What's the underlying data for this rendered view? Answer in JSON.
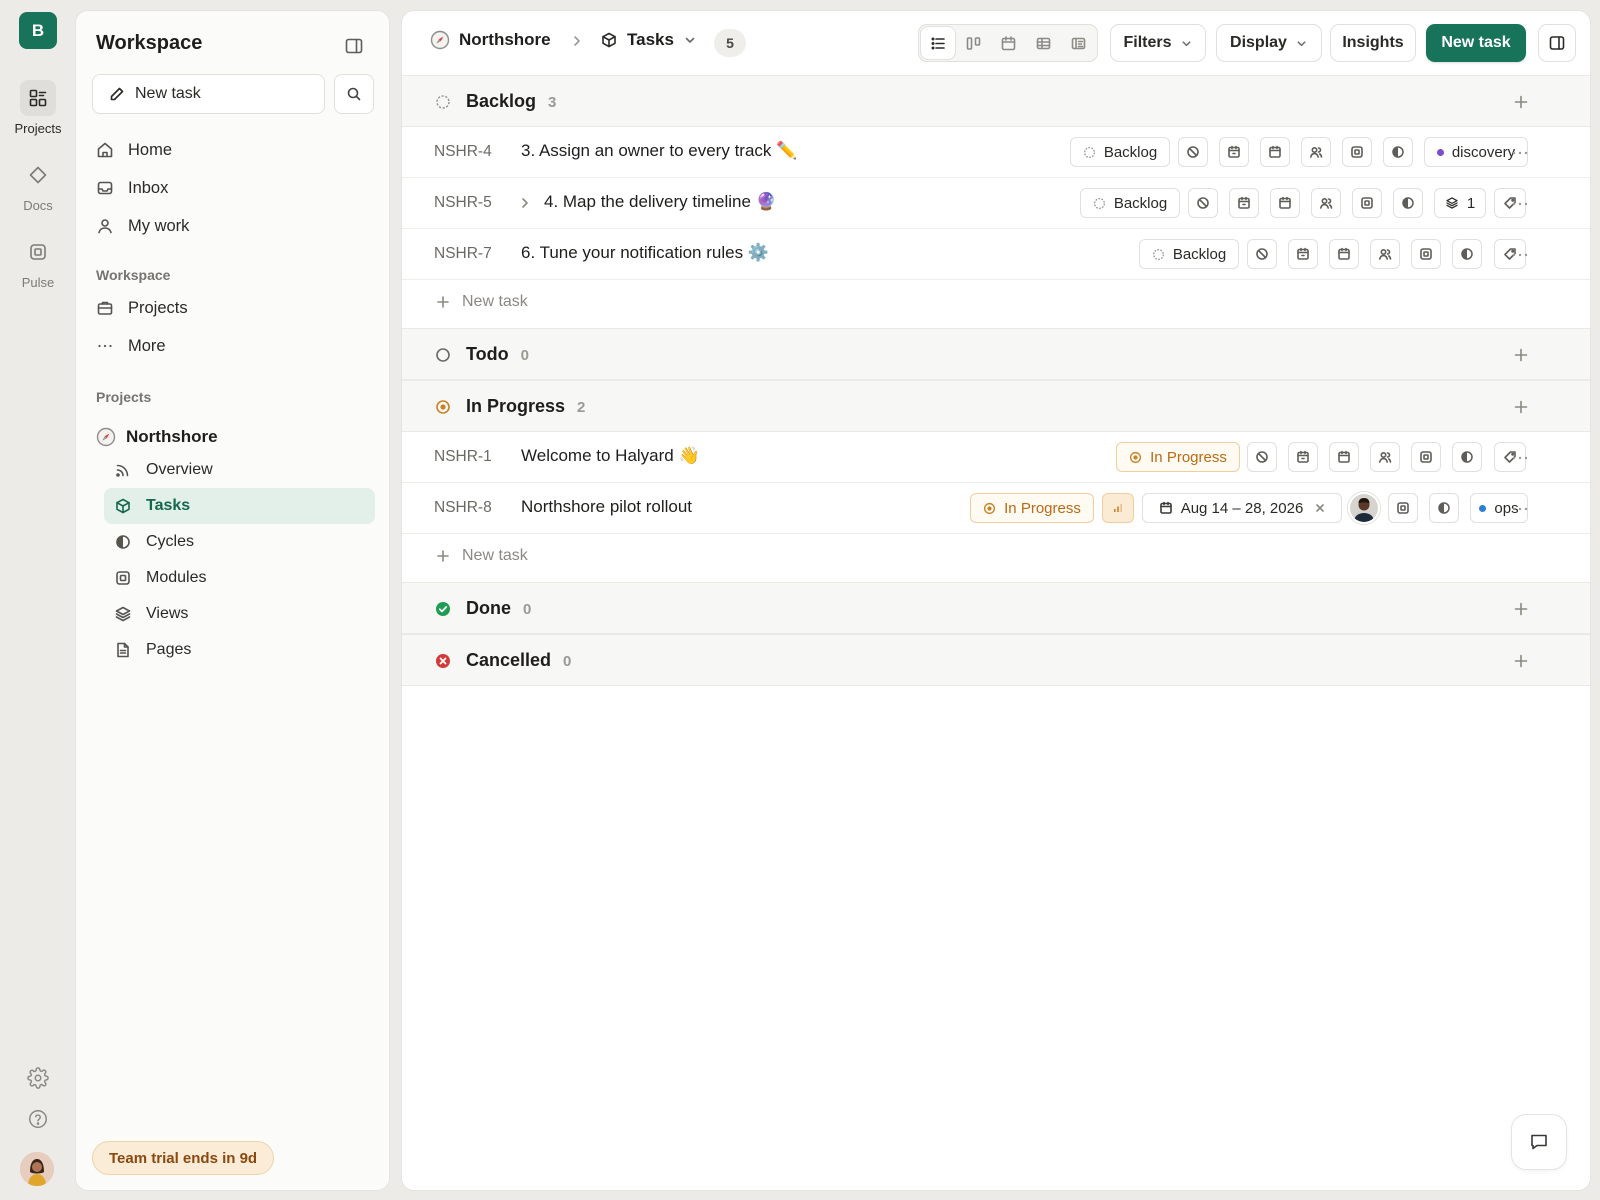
{
  "workspace": {
    "initial": "B",
    "name": "Workspace"
  },
  "rail": [
    {
      "label": "Projects",
      "icon": "projects-icon",
      "active": true
    },
    {
      "label": "Docs",
      "icon": "diamond-icon"
    },
    {
      "label": "Pulse",
      "icon": "pulse-icon"
    }
  ],
  "sidebar": {
    "new_task_label": "New task",
    "nav": [
      {
        "label": "Home",
        "icon": "home-icon"
      },
      {
        "label": "Inbox",
        "icon": "inbox-icon"
      },
      {
        "label": "My work",
        "icon": "user-icon"
      }
    ],
    "workspace_section": "Workspace",
    "workspace_items": [
      {
        "label": "Projects",
        "icon": "briefcase-icon"
      },
      {
        "label": "More",
        "icon": "more-icon"
      }
    ],
    "projects_section": "Projects",
    "project": {
      "name": "Northshore",
      "items": [
        {
          "label": "Overview",
          "icon": "rss-icon"
        },
        {
          "label": "Tasks",
          "icon": "cube-icon",
          "active": true
        },
        {
          "label": "Cycles",
          "icon": "half-circle-icon"
        },
        {
          "label": "Modules",
          "icon": "module-icon"
        },
        {
          "label": "Views",
          "icon": "layers-icon"
        },
        {
          "label": "Pages",
          "icon": "page-icon"
        }
      ]
    },
    "trial_text": "Team trial ends in 9d"
  },
  "header": {
    "project": "Northshore",
    "section": "Tasks",
    "count": "5",
    "filters_label": "Filters",
    "display_label": "Display",
    "insights_label": "Insights",
    "new_task_label": "New task"
  },
  "groups": [
    {
      "name": "Backlog",
      "count": "3",
      "status": "backlog",
      "tasks": [
        {
          "id": "NSHR-4",
          "title": "3. Assign an owner to every track ✏️",
          "state_label": "Backlog",
          "label": "discovery",
          "label_color": "#7c4dcc"
        },
        {
          "id": "NSHR-5",
          "title": "4. Map the delivery timeline 🔮",
          "state_label": "Backlog",
          "has_children": true,
          "sub_count": "1"
        },
        {
          "id": "NSHR-7",
          "title": "6. Tune your notification rules ⚙️",
          "state_label": "Backlog"
        }
      ],
      "new_task_label": "New task"
    },
    {
      "name": "Todo",
      "count": "0",
      "status": "todo"
    },
    {
      "name": "In Progress",
      "count": "2",
      "status": "inprogress",
      "tasks": [
        {
          "id": "NSHR-1",
          "title": "Welcome to Halyard 👋",
          "state_label": "In Progress"
        },
        {
          "id": "NSHR-8",
          "title": "Northshore pilot rollout",
          "state_label": "In Progress",
          "date_range": "Aug 14 – 28, 2026",
          "label": "ops",
          "label_color": "#2f7fd0"
        }
      ],
      "new_task_label": "New task"
    },
    {
      "name": "Done",
      "count": "0",
      "status": "done"
    },
    {
      "name": "Cancelled",
      "count": "0",
      "status": "cancelled"
    }
  ],
  "colors": {
    "accent": "#17735a",
    "in_progress": "#c98227",
    "done": "#1f9d55",
    "cancelled": "#d33b3b"
  }
}
